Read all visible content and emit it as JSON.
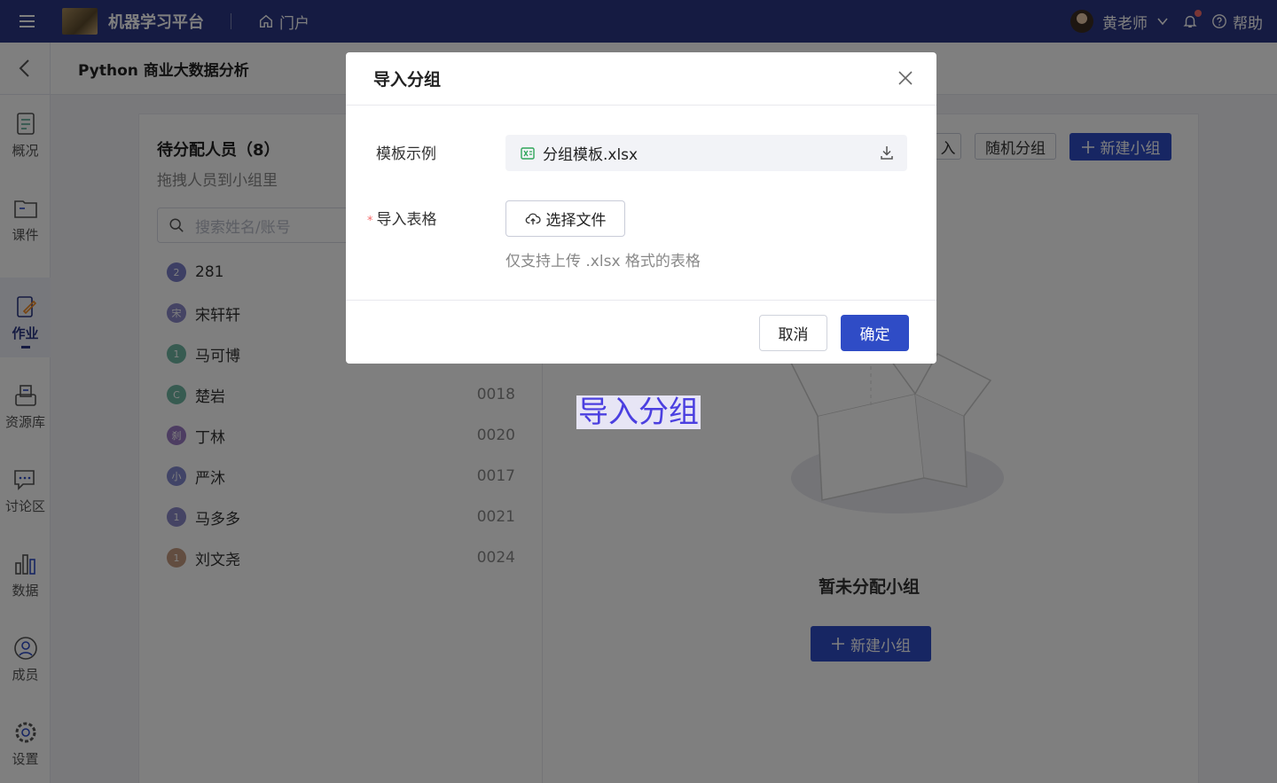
{
  "topbar": {
    "app_title": "机器学习平台",
    "portal_label": "门户",
    "user_name": "黄老师",
    "help_label": "帮助"
  },
  "subheader": {
    "course_title": "Python 商业大数据分析"
  },
  "sidenav": {
    "items": [
      {
        "label": "概况",
        "icon": "overview-icon"
      },
      {
        "label": "课件",
        "icon": "courseware-icon"
      },
      {
        "label": "作业",
        "icon": "homework-icon",
        "active": true
      },
      {
        "label": "资源库",
        "icon": "resource-icon"
      },
      {
        "label": "讨论区",
        "icon": "discussion-icon"
      },
      {
        "label": "数据",
        "icon": "data-icon"
      },
      {
        "label": "成员",
        "icon": "member-icon"
      },
      {
        "label": "设置",
        "icon": "settings-icon"
      }
    ]
  },
  "pending": {
    "title": "待分配人员（8）",
    "subtitle": "拖拽人员到小组里",
    "search_placeholder": "搜索姓名/账号",
    "members": [
      {
        "badge": "2",
        "name": "281",
        "account": "",
        "color": "#7a7fc8"
      },
      {
        "badge": "宋",
        "name": "宋轩轩",
        "account": "",
        "color": "#8b88c9"
      },
      {
        "badge": "1",
        "name": "马可博",
        "account": "",
        "color": "#6fb6a3"
      },
      {
        "badge": "C",
        "name": "楚岩",
        "account": "0018",
        "color": "#6fb6a3"
      },
      {
        "badge": "刹",
        "name": "丁林",
        "account": "0020",
        "color": "#9a7bc4"
      },
      {
        "badge": "小",
        "name": "严沐",
        "account": "0017",
        "color": "#8388cf"
      },
      {
        "badge": "1",
        "name": "马多多",
        "account": "0021",
        "color": "#8b88c9"
      },
      {
        "badge": "1",
        "name": "刘文尧",
        "account": "0024",
        "color": "#c49a80"
      }
    ]
  },
  "groups": {
    "import_button_partial": "入",
    "random_button": "随机分组",
    "new_group_button": "新建小组",
    "empty_text": "暂未分配小组",
    "empty_new_button": "新建小组"
  },
  "floating_label": "导入分组",
  "modal": {
    "title": "导入分组",
    "template_label": "模板示例",
    "template_file": "分组模板.xlsx",
    "import_label": "导入表格",
    "required_mark": "*",
    "upload_button": "选择文件",
    "hint": "仅支持上传 .xlsx 格式的表格",
    "cancel": "取消",
    "confirm": "确定"
  },
  "colors": {
    "topbar": "#2b3784",
    "primary": "#2f4cc6",
    "required": "#f56c6c"
  }
}
